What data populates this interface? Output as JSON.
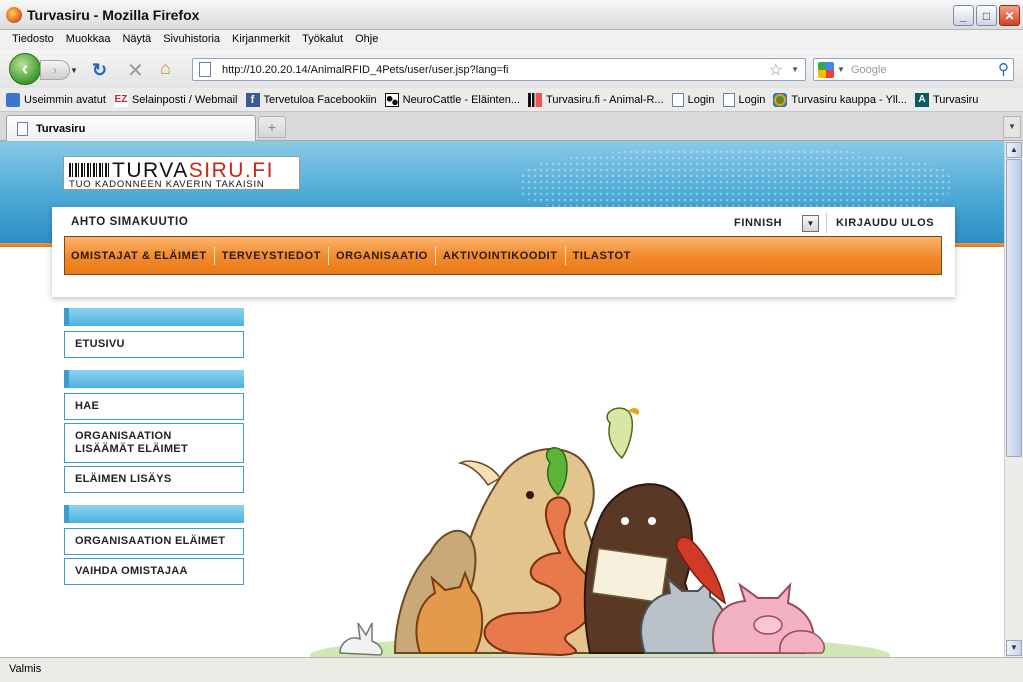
{
  "window": {
    "title": "Turvasiru - Mozilla Firefox",
    "min": "_",
    "max": "□",
    "close": "✕"
  },
  "menu": [
    "Tiedosto",
    "Muokkaa",
    "Näytä",
    "Sivuhistoria",
    "Kirjanmerkit",
    "Työkalut",
    "Ohje"
  ],
  "nav": {
    "url": "http://10.20.20.14/AnimalRFID_4Pets/user/user.jsp?lang=fi",
    "search_placeholder": "Google"
  },
  "bookmarks": [
    {
      "label": "Useimmin avatut",
      "icon": "mag2"
    },
    {
      "label": "Selainposti / Webmail",
      "icon": "ez"
    },
    {
      "label": "Tervetuloa Facebookiin",
      "icon": "fb"
    },
    {
      "label": "NeuroCattle - Eläinten...",
      "icon": "cow"
    },
    {
      "label": "Turvasiru.fi - Animal-R...",
      "icon": "tv"
    },
    {
      "label": "Login",
      "icon": "page"
    },
    {
      "label": "Login",
      "icon": "page"
    },
    {
      "label": "Turvasiru kauppa - Yll...",
      "icon": "joom"
    },
    {
      "label": "Turvasiru",
      "icon": "a"
    }
  ],
  "tab": {
    "label": "Turvasiru"
  },
  "site": {
    "brand_black": "TURVA",
    "brand_rest": "SIRU.FI",
    "slogan": "TUO KADONNEEN KAVERIN TAKAISIN",
    "user_name": "AHTO SIMAKUUTIO",
    "language": "FINNISH",
    "logout": "KIRJAUDU ULOS",
    "nav_items": [
      "OMISTAJAT & ELÄIMET",
      "TERVEYSTIEDOT",
      "ORGANISAATIO",
      "AKTIVOINTIKOODIT",
      "TILASTOT"
    ],
    "sidebar": [
      {
        "items": [
          "ETUSIVU"
        ]
      },
      {
        "items": [
          "HAE",
          "ORGANISAATION LISÄÄMÄT ELÄIMET",
          "ELÄIMEN LISÄYS"
        ]
      },
      {
        "items": [
          "ORGANISAATION ELÄIMET",
          "VAIHDA OMISTAJAA"
        ]
      }
    ]
  },
  "status": "Valmis"
}
